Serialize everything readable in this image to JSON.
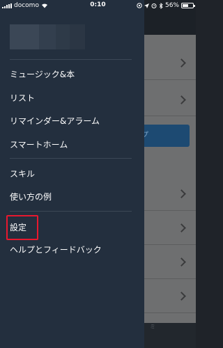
{
  "status_bar": {
    "carrier": "docomo",
    "time": "0:10",
    "battery_percent": "56%",
    "battery_level": 0.56,
    "icons": [
      "signal-icon",
      "wifi-icon",
      "lock-rotation-icon",
      "location-arrow-icon",
      "alarm-icon",
      "bluetooth-icon",
      "battery-icon"
    ]
  },
  "drawer": {
    "groups": [
      [
        "ミュージック&本",
        "リスト",
        "リマインダー&アラーム",
        "スマートホーム"
      ],
      [
        "スキル",
        "使い方の例"
      ],
      [
        "設定",
        "ヘルプとフィードバック"
      ]
    ],
    "highlighted_item": "設定",
    "highlight_color": "#e8182e",
    "background_color": "#232f3e"
  },
  "background_app": {
    "button_label_fragment": "プ",
    "bottom_text_fragment": "ミ"
  }
}
